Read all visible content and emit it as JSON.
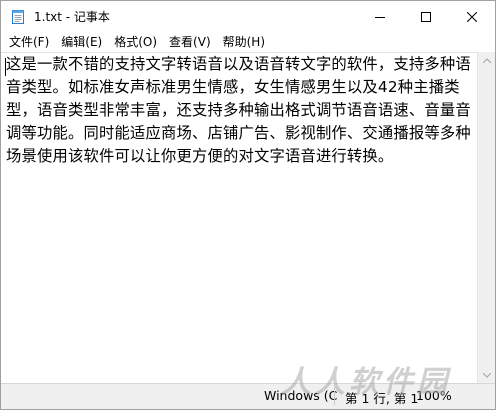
{
  "window": {
    "title": "1.txt - 记事本"
  },
  "window_controls": {
    "minimize_icon": "minimize-icon",
    "maximize_icon": "maximize-icon",
    "close_icon": "close-icon"
  },
  "menu": [
    {
      "label": "文件(F)"
    },
    {
      "label": "编辑(E)"
    },
    {
      "label": "格式(O)"
    },
    {
      "label": "查看(V)"
    },
    {
      "label": "帮助(H)"
    }
  ],
  "editor": {
    "text": "这是一款不错的支持文字转语音以及语音转文字的软件，支持多种语音类型。如标准女声标准男生情感，女生情感男生以及42种主播类型，语音类型非常丰富，还支持多种输出格式调节语音语速、音量音调等功能。同时能适应商场、店铺广告、影视制作、交通播报等多种场景使用该软件可以让你更方便的对文字语音进行转换。"
  },
  "status": {
    "encoding": "Windows (C",
    "position": "第 1 行, 第 1",
    "zoom": "100%"
  },
  "watermark": {
    "text": "人人软件园"
  }
}
